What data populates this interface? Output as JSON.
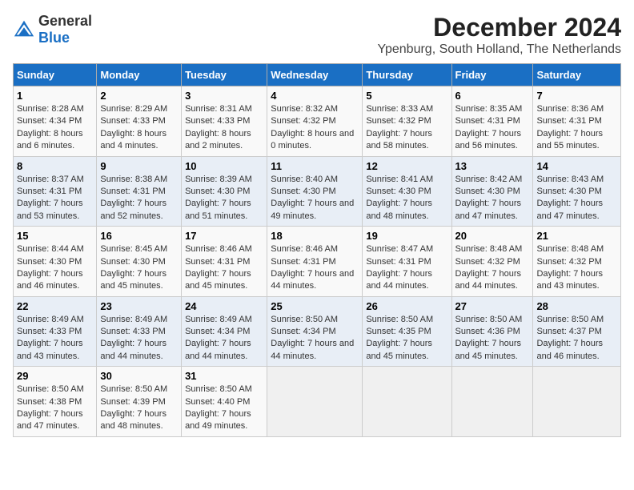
{
  "logo": {
    "general": "General",
    "blue": "Blue"
  },
  "title": "December 2024",
  "subtitle": "Ypenburg, South Holland, The Netherlands",
  "weekdays": [
    "Sunday",
    "Monday",
    "Tuesday",
    "Wednesday",
    "Thursday",
    "Friday",
    "Saturday"
  ],
  "weeks": [
    [
      {
        "day": "1",
        "sunrise": "Sunrise: 8:28 AM",
        "sunset": "Sunset: 4:34 PM",
        "daylight": "Daylight: 8 hours and 6 minutes."
      },
      {
        "day": "2",
        "sunrise": "Sunrise: 8:29 AM",
        "sunset": "Sunset: 4:33 PM",
        "daylight": "Daylight: 8 hours and 4 minutes."
      },
      {
        "day": "3",
        "sunrise": "Sunrise: 8:31 AM",
        "sunset": "Sunset: 4:33 PM",
        "daylight": "Daylight: 8 hours and 2 minutes."
      },
      {
        "day": "4",
        "sunrise": "Sunrise: 8:32 AM",
        "sunset": "Sunset: 4:32 PM",
        "daylight": "Daylight: 8 hours and 0 minutes."
      },
      {
        "day": "5",
        "sunrise": "Sunrise: 8:33 AM",
        "sunset": "Sunset: 4:32 PM",
        "daylight": "Daylight: 7 hours and 58 minutes."
      },
      {
        "day": "6",
        "sunrise": "Sunrise: 8:35 AM",
        "sunset": "Sunset: 4:31 PM",
        "daylight": "Daylight: 7 hours and 56 minutes."
      },
      {
        "day": "7",
        "sunrise": "Sunrise: 8:36 AM",
        "sunset": "Sunset: 4:31 PM",
        "daylight": "Daylight: 7 hours and 55 minutes."
      }
    ],
    [
      {
        "day": "8",
        "sunrise": "Sunrise: 8:37 AM",
        "sunset": "Sunset: 4:31 PM",
        "daylight": "Daylight: 7 hours and 53 minutes."
      },
      {
        "day": "9",
        "sunrise": "Sunrise: 8:38 AM",
        "sunset": "Sunset: 4:31 PM",
        "daylight": "Daylight: 7 hours and 52 minutes."
      },
      {
        "day": "10",
        "sunrise": "Sunrise: 8:39 AM",
        "sunset": "Sunset: 4:30 PM",
        "daylight": "Daylight: 7 hours and 51 minutes."
      },
      {
        "day": "11",
        "sunrise": "Sunrise: 8:40 AM",
        "sunset": "Sunset: 4:30 PM",
        "daylight": "Daylight: 7 hours and 49 minutes."
      },
      {
        "day": "12",
        "sunrise": "Sunrise: 8:41 AM",
        "sunset": "Sunset: 4:30 PM",
        "daylight": "Daylight: 7 hours and 48 minutes."
      },
      {
        "day": "13",
        "sunrise": "Sunrise: 8:42 AM",
        "sunset": "Sunset: 4:30 PM",
        "daylight": "Daylight: 7 hours and 47 minutes."
      },
      {
        "day": "14",
        "sunrise": "Sunrise: 8:43 AM",
        "sunset": "Sunset: 4:30 PM",
        "daylight": "Daylight: 7 hours and 47 minutes."
      }
    ],
    [
      {
        "day": "15",
        "sunrise": "Sunrise: 8:44 AM",
        "sunset": "Sunset: 4:30 PM",
        "daylight": "Daylight: 7 hours and 46 minutes."
      },
      {
        "day": "16",
        "sunrise": "Sunrise: 8:45 AM",
        "sunset": "Sunset: 4:30 PM",
        "daylight": "Daylight: 7 hours and 45 minutes."
      },
      {
        "day": "17",
        "sunrise": "Sunrise: 8:46 AM",
        "sunset": "Sunset: 4:31 PM",
        "daylight": "Daylight: 7 hours and 45 minutes."
      },
      {
        "day": "18",
        "sunrise": "Sunrise: 8:46 AM",
        "sunset": "Sunset: 4:31 PM",
        "daylight": "Daylight: 7 hours and 44 minutes."
      },
      {
        "day": "19",
        "sunrise": "Sunrise: 8:47 AM",
        "sunset": "Sunset: 4:31 PM",
        "daylight": "Daylight: 7 hours and 44 minutes."
      },
      {
        "day": "20",
        "sunrise": "Sunrise: 8:48 AM",
        "sunset": "Sunset: 4:32 PM",
        "daylight": "Daylight: 7 hours and 44 minutes."
      },
      {
        "day": "21",
        "sunrise": "Sunrise: 8:48 AM",
        "sunset": "Sunset: 4:32 PM",
        "daylight": "Daylight: 7 hours and 43 minutes."
      }
    ],
    [
      {
        "day": "22",
        "sunrise": "Sunrise: 8:49 AM",
        "sunset": "Sunset: 4:33 PM",
        "daylight": "Daylight: 7 hours and 43 minutes."
      },
      {
        "day": "23",
        "sunrise": "Sunrise: 8:49 AM",
        "sunset": "Sunset: 4:33 PM",
        "daylight": "Daylight: 7 hours and 44 minutes."
      },
      {
        "day": "24",
        "sunrise": "Sunrise: 8:49 AM",
        "sunset": "Sunset: 4:34 PM",
        "daylight": "Daylight: 7 hours and 44 minutes."
      },
      {
        "day": "25",
        "sunrise": "Sunrise: 8:50 AM",
        "sunset": "Sunset: 4:34 PM",
        "daylight": "Daylight: 7 hours and 44 minutes."
      },
      {
        "day": "26",
        "sunrise": "Sunrise: 8:50 AM",
        "sunset": "Sunset: 4:35 PM",
        "daylight": "Daylight: 7 hours and 45 minutes."
      },
      {
        "day": "27",
        "sunrise": "Sunrise: 8:50 AM",
        "sunset": "Sunset: 4:36 PM",
        "daylight": "Daylight: 7 hours and 45 minutes."
      },
      {
        "day": "28",
        "sunrise": "Sunrise: 8:50 AM",
        "sunset": "Sunset: 4:37 PM",
        "daylight": "Daylight: 7 hours and 46 minutes."
      }
    ],
    [
      {
        "day": "29",
        "sunrise": "Sunrise: 8:50 AM",
        "sunset": "Sunset: 4:38 PM",
        "daylight": "Daylight: 7 hours and 47 minutes."
      },
      {
        "day": "30",
        "sunrise": "Sunrise: 8:50 AM",
        "sunset": "Sunset: 4:39 PM",
        "daylight": "Daylight: 7 hours and 48 minutes."
      },
      {
        "day": "31",
        "sunrise": "Sunrise: 8:50 AM",
        "sunset": "Sunset: 4:40 PM",
        "daylight": "Daylight: 7 hours and 49 minutes."
      },
      null,
      null,
      null,
      null
    ]
  ]
}
